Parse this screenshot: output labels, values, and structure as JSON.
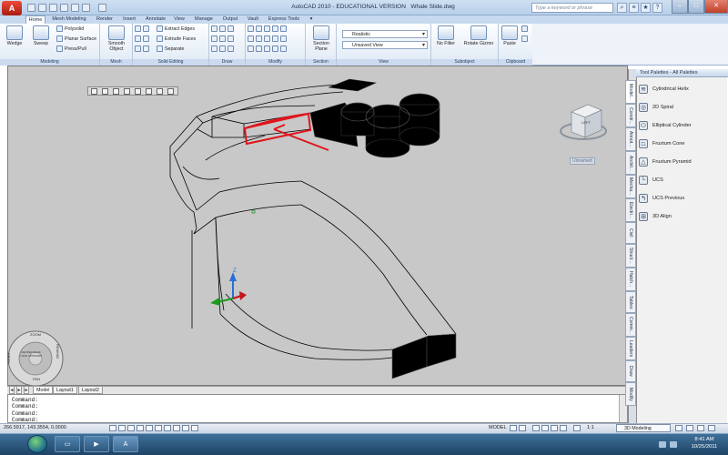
{
  "app": {
    "logo_letter": "A",
    "window_title": "AutoCAD 2010 - EDUCATIONAL VERSION",
    "file_name": "Whale Slide.dwg",
    "search_placeholder": "Type a keyword or phrase"
  },
  "ribbon_tabs": [
    "Home",
    "Mesh Modeling",
    "Render",
    "Insert",
    "Annotate",
    "View",
    "Manage",
    "Output",
    "Vault",
    "Express Tools"
  ],
  "ribbon": {
    "modeling": {
      "title": "Modeling",
      "wedge": "Wedge",
      "sweep": "Sweep",
      "polysolid": "Polysolid",
      "planar_surface": "Planar Surface",
      "press_pull": "Press/Pull"
    },
    "mesh": {
      "title": "Mesh",
      "smooth_object_1": "Smooth",
      "smooth_object_2": "Object"
    },
    "solid_editing": {
      "title": "Solid Editing",
      "extract_edges": "Extract Edges",
      "extrude_faces": "Extrude Faces",
      "separate": "Separate"
    },
    "draw": {
      "title": "Draw"
    },
    "modify": {
      "title": "Modify"
    },
    "section": {
      "title": "Section",
      "section_plane_1": "Section",
      "section_plane_2": "Plane"
    },
    "view": {
      "title": "View",
      "visual_style": "Realistic",
      "named_view": "Unsaved View"
    },
    "subobject": {
      "title": "Subobject",
      "no_filter": "No Filter",
      "rotate_gizmo": "Rotate Gizmo"
    },
    "clipboard": {
      "title": "Clipboard",
      "paste": "Paste"
    }
  },
  "viewport": {
    "viewcube_face": "LEFT",
    "viewcube_caption": "Unnamed",
    "ucs_axis_label": "Z",
    "wheel": {
      "top": "ZOOM",
      "left": "ORBIT",
      "right": "REWIND",
      "bottom": "PAN",
      "inner": "CENTER WALK LOOK UP/DOWN"
    }
  },
  "layout_tabs": [
    "Model",
    "Layout1",
    "Layout2"
  ],
  "command_lines": [
    "Command:",
    "Command:",
    "Command:",
    "Command:"
  ],
  "status_bar": {
    "coordinates": "266.5917, 143.3554, 0.0000",
    "model_label": "MODEL",
    "scale": "1:1",
    "workspace": "3D Modeling"
  },
  "tool_palette": {
    "title": "Tool Palettes - All Palettes",
    "items": [
      {
        "label": "Cylindrical Helix",
        "icon": "helix-icon"
      },
      {
        "label": "2D Spiral",
        "icon": "spiral-icon"
      },
      {
        "label": "Elliptical Cylinder",
        "icon": "elliptical-cylinder-icon"
      },
      {
        "label": "Frustum Cone",
        "icon": "frustum-cone-icon"
      },
      {
        "label": "Frustum Pyramid",
        "icon": "frustum-pyramid-icon"
      },
      {
        "label": "UCS",
        "icon": "ucs-icon"
      },
      {
        "label": "UCS Previous",
        "icon": "ucs-previous-icon"
      },
      {
        "label": "3D Align",
        "icon": "3d-align-icon"
      }
    ],
    "side_tabs": [
      "Model...",
      "Constr...",
      "Annot...",
      "Archit...",
      "Mecha...",
      "Electri...",
      "Civil",
      "Struct...",
      "Hatch...",
      "Tables",
      "Comm...",
      "Leaders",
      "Draw",
      "Modify"
    ]
  },
  "taskbar": {
    "time": "8:41 AM",
    "date": "10/25/2011"
  },
  "colors": {
    "viewport_bg": "#c8c8c8",
    "selection_red": "#e0151b",
    "solid_black": "#000000"
  }
}
